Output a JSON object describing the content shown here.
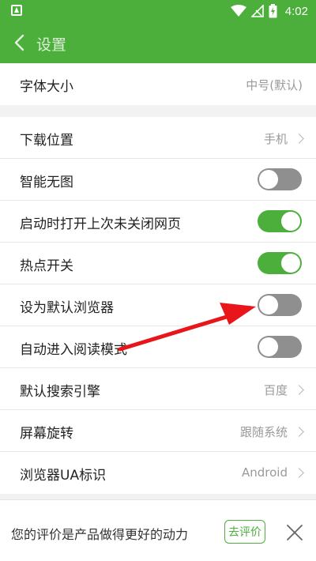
{
  "statusbar": {
    "time": "4:02"
  },
  "appbar": {
    "title": "设置"
  },
  "font_size": {
    "label": "字体大小",
    "value": "中号(默认)"
  },
  "settings": [
    {
      "label": "下载位置",
      "value": "手机",
      "type": "link"
    },
    {
      "label": "智能无图",
      "type": "toggle",
      "on": false
    },
    {
      "label": "启动时打开上次未关闭网页",
      "type": "toggle",
      "on": true
    },
    {
      "label": "热点开关",
      "type": "toggle",
      "on": true
    },
    {
      "label": "设为默认浏览器",
      "type": "toggle",
      "on": false
    },
    {
      "label": "自动进入阅读模式",
      "type": "toggle",
      "on": false
    },
    {
      "label": "默认搜索引擎",
      "value": "百度",
      "type": "link"
    },
    {
      "label": "屏幕旋转",
      "value": "跟随系统",
      "type": "link"
    },
    {
      "label": "浏览器UA标识",
      "value": "Android",
      "type": "link"
    }
  ],
  "feedback": {
    "message": "您的评价是产品做得更好的动力",
    "button": "去评价"
  },
  "colors": {
    "brand": "#4caf3c",
    "toggle_off": "#8f8f8f",
    "annotation": "#e8161b"
  }
}
